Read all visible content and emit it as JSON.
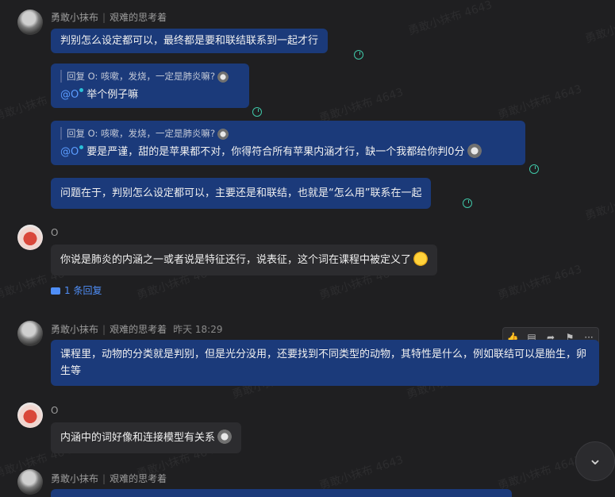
{
  "watermark": "勇敢小抹布 4643",
  "messages": [
    {
      "id": "m1",
      "sender": "勇敢小抹布",
      "channel": "艰难的思考着",
      "bubbles": [
        "判别怎么设定都可以，最终都是要和联结联系到一起才行"
      ]
    },
    {
      "id": "q1",
      "quote": "回复 O: 咳嗽，发烧，一定是肺炎嘛?",
      "mention": "@O",
      "text": "举个例子嘛"
    },
    {
      "id": "q2",
      "quote": "回复 O: 咳嗽，发烧，一定是肺炎嘛?",
      "mention": "@O",
      "text": "要是严谨，甜的是苹果都不对，你得符合所有苹果内涵才行，缺一个我都给你判0分"
    },
    {
      "id": "m2",
      "text": "问题在于，判别怎么设定都可以，主要还是和联结，也就是“怎么用”联系在一起"
    },
    {
      "id": "m3",
      "sender": "O",
      "text": "你说是肺炎的内涵之一或者说是特征还行，说表征，这个词在课程中被定义了",
      "replies": "1 条回复"
    },
    {
      "id": "m4",
      "sender": "勇敢小抹布",
      "channel": "艰难的思考着",
      "time": "昨天 18:29",
      "text": "课程里，动物的分类就是判别，但是光分没用，还要找到不同类型的动物，其特性是什么，例如联结可以是胎生，卵生等"
    },
    {
      "id": "m5",
      "sender": "O",
      "text": "内涵中的词好像和连接模型有关系"
    },
    {
      "id": "m6",
      "sender": "勇敢小抹布",
      "channel": "艰难的思考着"
    }
  ],
  "toolbar": {
    "icons": [
      "thumbs-up-icon",
      "comment-icon",
      "share-icon",
      "flag-icon",
      "more-icon"
    ],
    "more": "···"
  },
  "scroll_down_icon": "chevron-double-down-icon"
}
